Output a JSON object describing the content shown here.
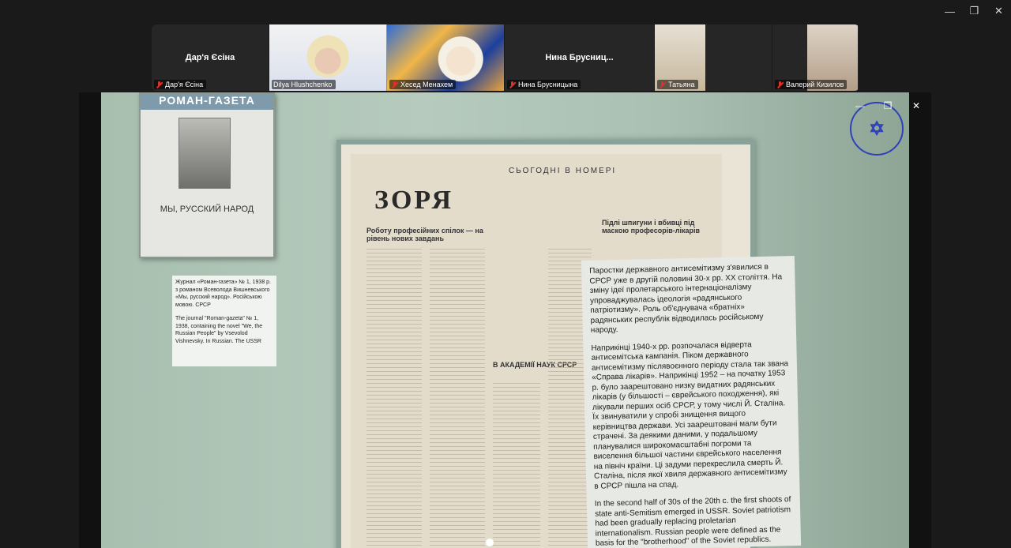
{
  "window": {
    "minimize_glyph": "—",
    "restore_glyph": "❐",
    "close_glyph": "✕"
  },
  "participants": [
    {
      "name_center": "Дар'я Єсіна",
      "label": "Дар'я Єсіна",
      "muted": true,
      "video": false
    },
    {
      "name_center": "",
      "label": "Dilya Hlushchenko",
      "muted": false,
      "video": true,
      "active": true
    },
    {
      "name_center": "",
      "label": "Хесед Менахем",
      "muted": true,
      "video": true
    },
    {
      "name_center": "Нина  Брусниц...",
      "label": "Нина Брусницына",
      "muted": true,
      "video": false
    },
    {
      "name_center": "",
      "label": "Татьяна",
      "muted": true,
      "video": true
    },
    {
      "name_center": "",
      "label": "Валерий Кизилов",
      "muted": true,
      "video": true
    }
  ],
  "share": {
    "poster": {
      "header": "РОМАН-ГАЗЕТА",
      "title": "МЫ, РУССКИЙ НАРОД"
    },
    "caption": {
      "uk": "Журнал «Роман-газета» № 1, 1938 р. з романом Всеволода Вишневського «Мы, русский народ». Російською мовою. СРСР",
      "en": "The journal \"Roman-gazeta\" № 1, 1938, containing the novel \"We, the Russian People\" by Vsevolod Vishnevsky. In Russian. The USSR"
    },
    "newspaper": {
      "title": "ЗОРЯ",
      "heading": "СЬОГОДНІ В НОМЕРІ",
      "sub1": "Роботу професійних спілок — на рівень нових завдань",
      "sub2": "Підлі шпигуни і вбивці під маскою професорів-лікарів",
      "sub3": "В АКАДЕМІЇ НАУК СРСР"
    },
    "panel": {
      "p1": "Паростки державного антисемітизму з'явилися в СРСР уже в другій половині 30-х рр. XX століття. На зміну ідеї пролетарського інтернаціоналізму упроваджувалась ідеологія «радянського патріотизму». Роль об'єднувача «братніх» радянських республік відводилась російському народу.",
      "p2": "Наприкінці 1940-х рр. розпочалася відверта антисемітська кампанія. Піком державного антисемітизму післявоєнного періоду стала так звана «Справа лікарів». Наприкінці 1952 – на початку 1953 р. було заарештовано низку видатних радянських лікарів (у більшості – єврейського походження), які лікували перших осіб СРСР, у тому числі Й. Сталіна. Їх звинуватили у спробі знищення вищого керівництва держави. Усі заарештовані мали бути страчені. За деякими даними, у подальшому планувалися широкомасштабні погроми та виселення більшої частини єврейського населення на північ країни. Ці задуми перекреслила смерть Й. Сталіна, після якої хвиля державного антисемітизму в СРСР пішла на спад.",
      "p3": "In the second half of 30s of the 20th c. the first shoots of state anti-Semitism emerged in USSR. Soviet patriotism had been gradually replacing proletarian internationalism. Russian people were defined as the basis for the \"brotherhood\" of the Soviet republics."
    }
  }
}
